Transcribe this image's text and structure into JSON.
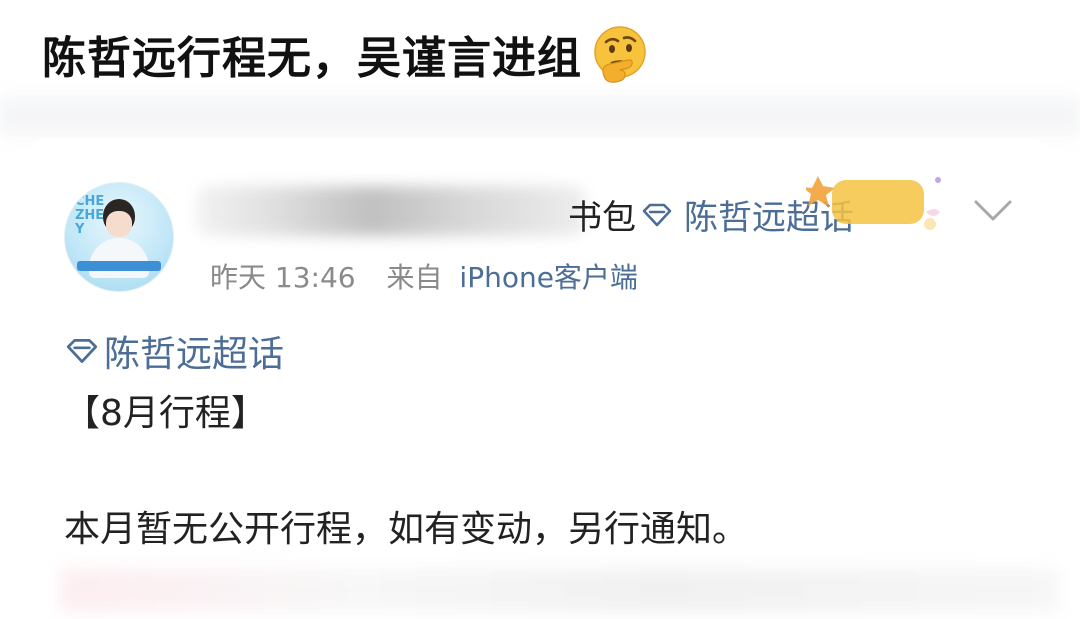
{
  "headline": {
    "text": "陈哲远行程无，吴谨言进组",
    "emoji": "thinking-face-emoji"
  },
  "post": {
    "username_visible_tail": "书包",
    "header_topic": "陈哲远超话",
    "badge_icon": "supertopic-badge-icon",
    "time": "昨天 13:46",
    "source_label": "来自",
    "source_client": "iPhone客户端",
    "topic_link": "陈哲远超话",
    "heading": "【8月行程】",
    "body": "本月暂无公开行程，如有变动，另行通知。"
  },
  "colors": {
    "link": "#4b6d96",
    "meta": "#8a8a8a",
    "text": "#222222",
    "badge": "#f6c343"
  }
}
